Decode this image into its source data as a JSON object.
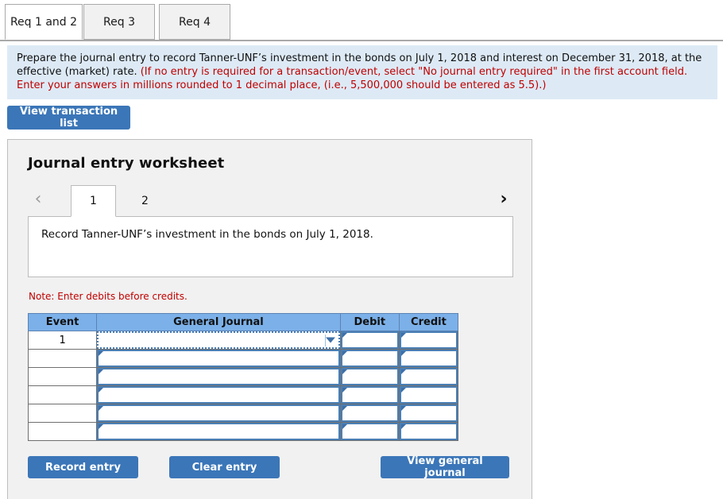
{
  "tabs": [
    {
      "label": "Req 1 and 2",
      "active": true
    },
    {
      "label": "Req 3",
      "active": false
    },
    {
      "label": "Req 4",
      "active": false
    }
  ],
  "instructions": {
    "black_part": "Prepare the journal entry to record Tanner-UNF’s investment in the bonds on July 1, 2018 and interest on December 31, 2018, at the effective (market) rate. ",
    "red_part": "(If no entry is required for a transaction/event, select \"No journal entry required\" in the first account field. Enter your answers in millions rounded to 1 decimal place, (i.e., 5,500,000 should be entered as 5.5).)"
  },
  "toolbar": {
    "view_transaction_list_label": "View transaction list"
  },
  "worksheet": {
    "title": "Journal entry worksheet",
    "pager": {
      "prev_icon": "‹",
      "next_icon": "›",
      "pages": [
        {
          "label": "1",
          "active": true
        },
        {
          "label": "2",
          "active": false
        }
      ]
    },
    "description": "Record Tanner-UNF’s investment in the bonds on July 1, 2018.",
    "note": "Note: Enter debits before credits.",
    "table": {
      "headers": [
        "Event",
        "General Journal",
        "Debit",
        "Credit"
      ],
      "rows": [
        {
          "event": "1",
          "journal": "",
          "debit": "",
          "credit": "",
          "has_dropdown": true,
          "focused": true
        },
        {
          "event": "",
          "journal": "",
          "debit": "",
          "credit": "",
          "has_dropdown": false,
          "focused": false
        },
        {
          "event": "",
          "journal": "",
          "debit": "",
          "credit": "",
          "has_dropdown": false,
          "focused": false
        },
        {
          "event": "",
          "journal": "",
          "debit": "",
          "credit": "",
          "has_dropdown": false,
          "focused": false
        },
        {
          "event": "",
          "journal": "",
          "debit": "",
          "credit": "",
          "has_dropdown": false,
          "focused": false
        },
        {
          "event": "",
          "journal": "",
          "debit": "",
          "credit": "",
          "has_dropdown": false,
          "focused": false
        }
      ]
    },
    "buttons": {
      "record_entry": "Record entry",
      "clear_entry": "Clear entry",
      "view_general_journal": "View general journal"
    }
  },
  "colors": {
    "accent_blue": "#3b76b8",
    "header_blue": "#7cb0e8",
    "banner_blue": "#ddeaf6",
    "panel_gray": "#f1f1f1",
    "red_text": "#c00000",
    "input_border": "#4a7fb5"
  }
}
